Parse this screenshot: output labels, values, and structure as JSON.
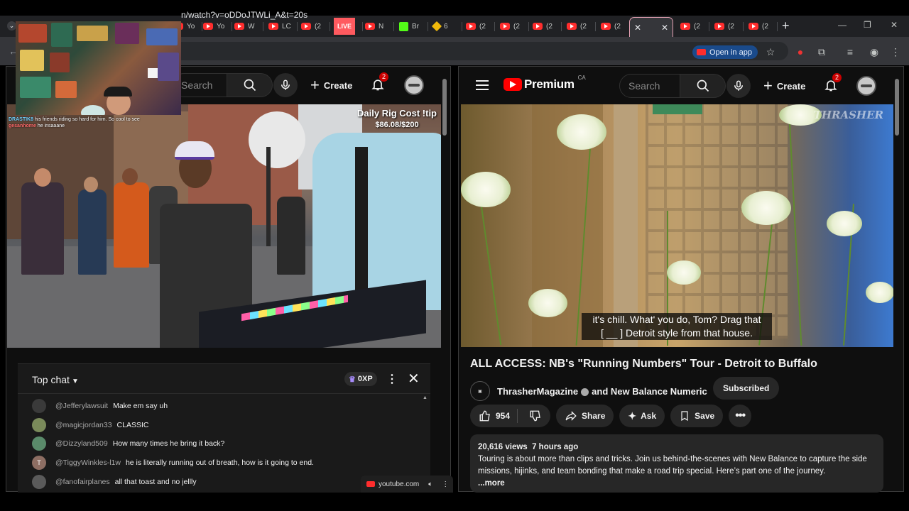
{
  "browser": {
    "tabs": [
      {
        "label": "Yo",
        "icon": "youtube-icon"
      },
      {
        "label": "Yo",
        "icon": "youtube-icon"
      },
      {
        "label": "W",
        "icon": "youtube-icon"
      },
      {
        "label": "LC",
        "icon": "youtube-icon"
      },
      {
        "label": "(2",
        "icon": "youtube-icon"
      },
      {
        "label": "LIVE",
        "icon": "live-badge"
      },
      {
        "label": "N",
        "icon": "youtube-icon"
      },
      {
        "label": "Br",
        "icon": "kick-icon"
      },
      {
        "label": "6",
        "icon": "binance-icon"
      },
      {
        "label": "(2",
        "icon": "youtube-icon"
      },
      {
        "label": "(2",
        "icon": "youtube-icon"
      },
      {
        "label": "(2",
        "icon": "youtube-icon"
      },
      {
        "label": "(2",
        "icon": "youtube-icon"
      },
      {
        "label": "(2",
        "icon": "youtube-icon"
      },
      {
        "label": "(2",
        "icon": "youtube-icon"
      },
      {
        "label": "(2",
        "icon": "youtube-icon"
      },
      {
        "label": "(2",
        "icon": "youtube-icon"
      }
    ],
    "new_tab": "+",
    "url": "n/watch?v=oDDoJTWLi_A&t=20s",
    "open_in_app": "Open in app"
  },
  "stream_overlay": {
    "chat_line1_user": "DRASTIK8",
    "chat_line1_text": "his friends riding so hard for him. So cool to see",
    "chat_line2_user": "gesanhome",
    "chat_line2_text": "he insaaane"
  },
  "left_pane": {
    "search_placeholder": "Search",
    "create_label": "Create",
    "notif_count": "2",
    "overlay_line1": "Daily Rig Cost !tip",
    "overlay_line2": "$86.08/$200",
    "chat": {
      "title": "Top chat",
      "xp_label": "0XP",
      "messages": [
        {
          "author": "@Jefferylawsuit",
          "text": "Make em say uh",
          "avatar_color": "#3a3a3a",
          "initial": ""
        },
        {
          "author": "@magicjordan33",
          "text": "CLASSIC",
          "avatar_color": "#7a8a5a",
          "initial": ""
        },
        {
          "author": "@Dizzyland509",
          "text": "How many times he bring it back?",
          "avatar_color": "#5a8a6a",
          "initial": ""
        },
        {
          "author": "@TiggyWinkles-l1w",
          "text": "he is literally running out of breath, how is it going to end.",
          "avatar_color": "#8d6e63",
          "initial": "T"
        },
        {
          "author": "@fanofairplanes",
          "text": "all that toast and no jellly",
          "avatar_color": "#5a5a5a",
          "initial": ""
        }
      ]
    },
    "domain_label": "youtube.com"
  },
  "right_pane": {
    "logo_text": "Premium",
    "logo_region": "CA",
    "search_placeholder": "Search",
    "create_label": "Create",
    "notif_count": "2",
    "watermark": "THRASHER",
    "subtitle_line1": "it's chill. What' you do, Tom? Drag that",
    "subtitle_line2": "[ __ ] Detroit style from that house.",
    "video_title": "ALL ACCESS: NB's \"Running Numbers\" Tour - Detroit to Buffalo",
    "channel_name": "ThrasherMagazine",
    "channel_collab": "and New Balance Numeric",
    "subscribe_label": "Subscribed",
    "likes": "954",
    "share_label": "Share",
    "ask_label": "Ask",
    "save_label": "Save",
    "views": "20,616 views",
    "age": "7 hours ago",
    "description": "Touring is about more than clips and tricks. Join us behind-the-scenes with New Balance to capture the side missions, hijinks, and team bonding that make a road trip special. Here’s part one of the journey.",
    "more_label": "...more"
  }
}
